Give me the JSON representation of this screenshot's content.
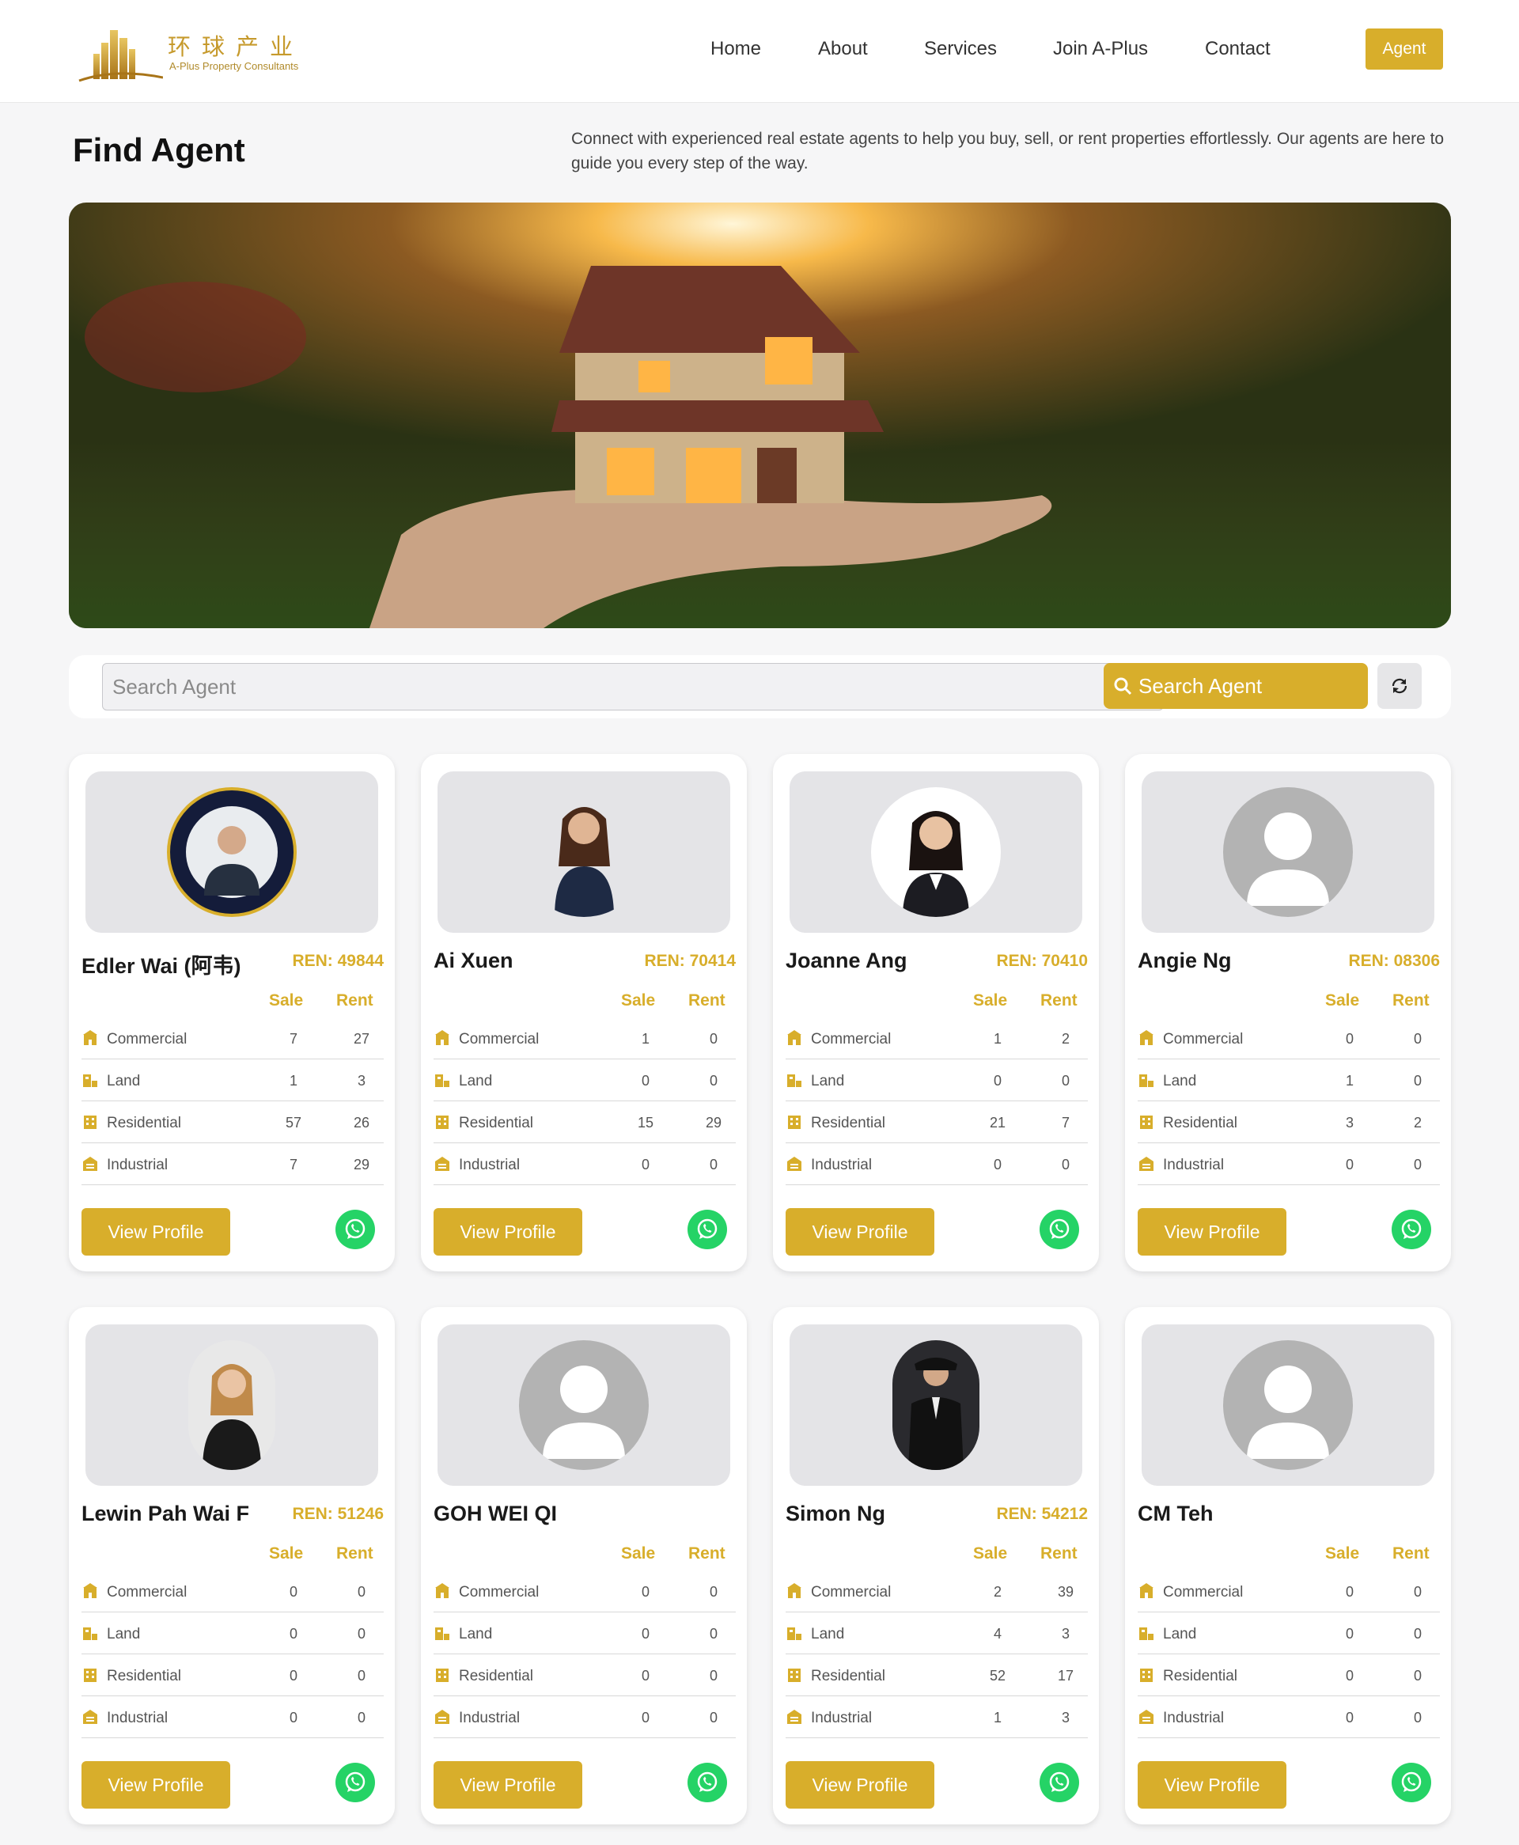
{
  "brand": {
    "cn": "环球产业",
    "en": "A-Plus Property Consultants"
  },
  "nav": {
    "items": [
      "Home",
      "About",
      "Services",
      "Join A-Plus",
      "Contact"
    ],
    "agent_label": "Agent"
  },
  "page": {
    "title": "Find Agent",
    "description": "Connect with experienced real estate agents to help you buy, sell, or rent properties effortlessly. Our agents are here to guide you every step of the way."
  },
  "search": {
    "placeholder": "Search Agent",
    "button_label": "Search Agent"
  },
  "table_headers": {
    "sale": "Sale",
    "rent": "Rent"
  },
  "categories": [
    "Commercial",
    "Land",
    "Residential",
    "Industrial"
  ],
  "view_profile_label": "View Profile",
  "colors": {
    "accent": "#d8ae2b",
    "whatsapp": "#25d366"
  },
  "agents": [
    {
      "name": "Edler Wai (阿韦)",
      "ren": "REN: 49844",
      "photo": "photo-badge",
      "stats": [
        [
          7,
          27
        ],
        [
          1,
          3
        ],
        [
          57,
          26
        ],
        [
          7,
          29
        ]
      ]
    },
    {
      "name": "Ai Xuen",
      "ren": "REN: 70414",
      "photo": "photo-woman",
      "stats": [
        [
          1,
          0
        ],
        [
          0,
          0
        ],
        [
          15,
          29
        ],
        [
          0,
          0
        ]
      ]
    },
    {
      "name": "Joanne Ang",
      "ren": "REN: 70410",
      "photo": "photo-woman-white",
      "stats": [
        [
          1,
          2
        ],
        [
          0,
          0
        ],
        [
          21,
          7
        ],
        [
          0,
          0
        ]
      ]
    },
    {
      "name": "Angie Ng",
      "ren": "REN: 08306",
      "photo": "avatar-placeholder",
      "stats": [
        [
          0,
          0
        ],
        [
          1,
          0
        ],
        [
          3,
          2
        ],
        [
          0,
          0
        ]
      ]
    },
    {
      "name": "Lewin Pah Wai F",
      "ren": "REN: 51246",
      "photo": "photo-woman-oval",
      "stats": [
        [
          0,
          0
        ],
        [
          0,
          0
        ],
        [
          0,
          0
        ],
        [
          0,
          0
        ]
      ]
    },
    {
      "name": "GOH WEI QI",
      "ren": "",
      "photo": "avatar-placeholder",
      "stats": [
        [
          0,
          0
        ],
        [
          0,
          0
        ],
        [
          0,
          0
        ],
        [
          0,
          0
        ]
      ]
    },
    {
      "name": "Simon Ng",
      "ren": "REN: 54212",
      "photo": "photo-man-dark",
      "stats": [
        [
          2,
          39
        ],
        [
          4,
          3
        ],
        [
          52,
          17
        ],
        [
          1,
          3
        ]
      ]
    },
    {
      "name": "CM Teh",
      "ren": "",
      "photo": "avatar-placeholder",
      "stats": [
        [
          0,
          0
        ],
        [
          0,
          0
        ],
        [
          0,
          0
        ],
        [
          0,
          0
        ]
      ]
    }
  ]
}
